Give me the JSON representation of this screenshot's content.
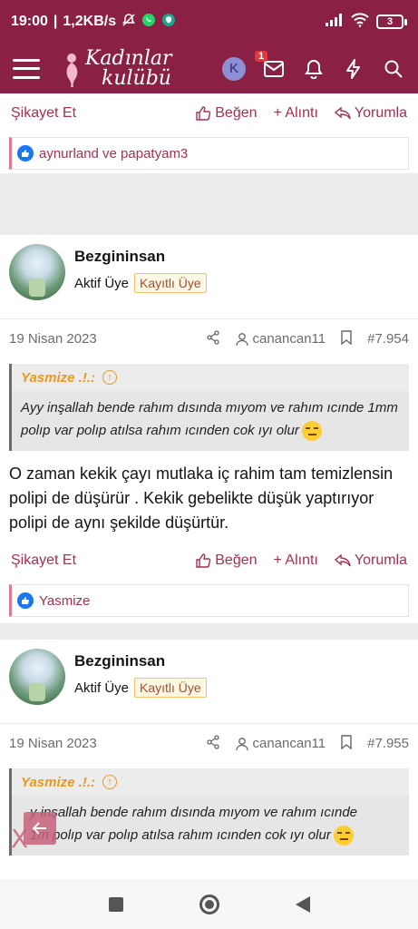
{
  "status_bar": {
    "time": "19:00",
    "speed": "1,2KB/s",
    "battery": "3"
  },
  "header": {
    "logo_line1": "Kadınlar",
    "logo_line2": "kulübü",
    "avatar_letter": "K",
    "notification_count": "1"
  },
  "top_actions": {
    "report": "Şikayet Et",
    "like": "Beğen",
    "quote": "+ Alıntı",
    "reply": "Yorumla"
  },
  "top_likes": "aynurland ve papatyam3",
  "posts": [
    {
      "username": "Bezgininsan",
      "role": "Aktif Üye",
      "badge": "Kayıtlı Üye",
      "date": "19 Nisan 2023",
      "reply_to": "canancan11",
      "post_number": "#7.954",
      "quote_author": "Yasmize .!.:",
      "quote_text": "Ayy inşallah bende rahım dısında mıyom ve rahım ıcınde 1mm polıp var polıp atılsa rahım ıcınden cok ıyı olur",
      "message": "O zaman kekik çayı mutlaka iç rahim tam temizlensin polipi de düşürür . Kekik gebelikte düşük yaptırıyor polipi de aynı şekilde düşürtür.",
      "report": "Şikayet Et",
      "like": "Beğen",
      "quote": "+ Alıntı",
      "reply": "Yorumla",
      "likes": "Yasmize"
    },
    {
      "username": "Bezgininsan",
      "role": "Aktif Üye",
      "badge": "Kayıtlı Üye",
      "date": "19 Nisan 2023",
      "reply_to": "canancan11",
      "post_number": "#7.955",
      "quote_author": "Yasmize .!.:",
      "quote_text_line1": "y inşallah bende rahım dısında mıyom ve rahım ıcınde",
      "quote_text_line2": "1m polıp var polıp atılsa rahım ıcınden cok ıyı olur"
    }
  ],
  "floating": {
    "close": "X"
  },
  "colors": {
    "brand": "#8a2145",
    "accent": "#a33153",
    "quote_author": "#e89a1d",
    "like_blue": "#1877f2"
  }
}
